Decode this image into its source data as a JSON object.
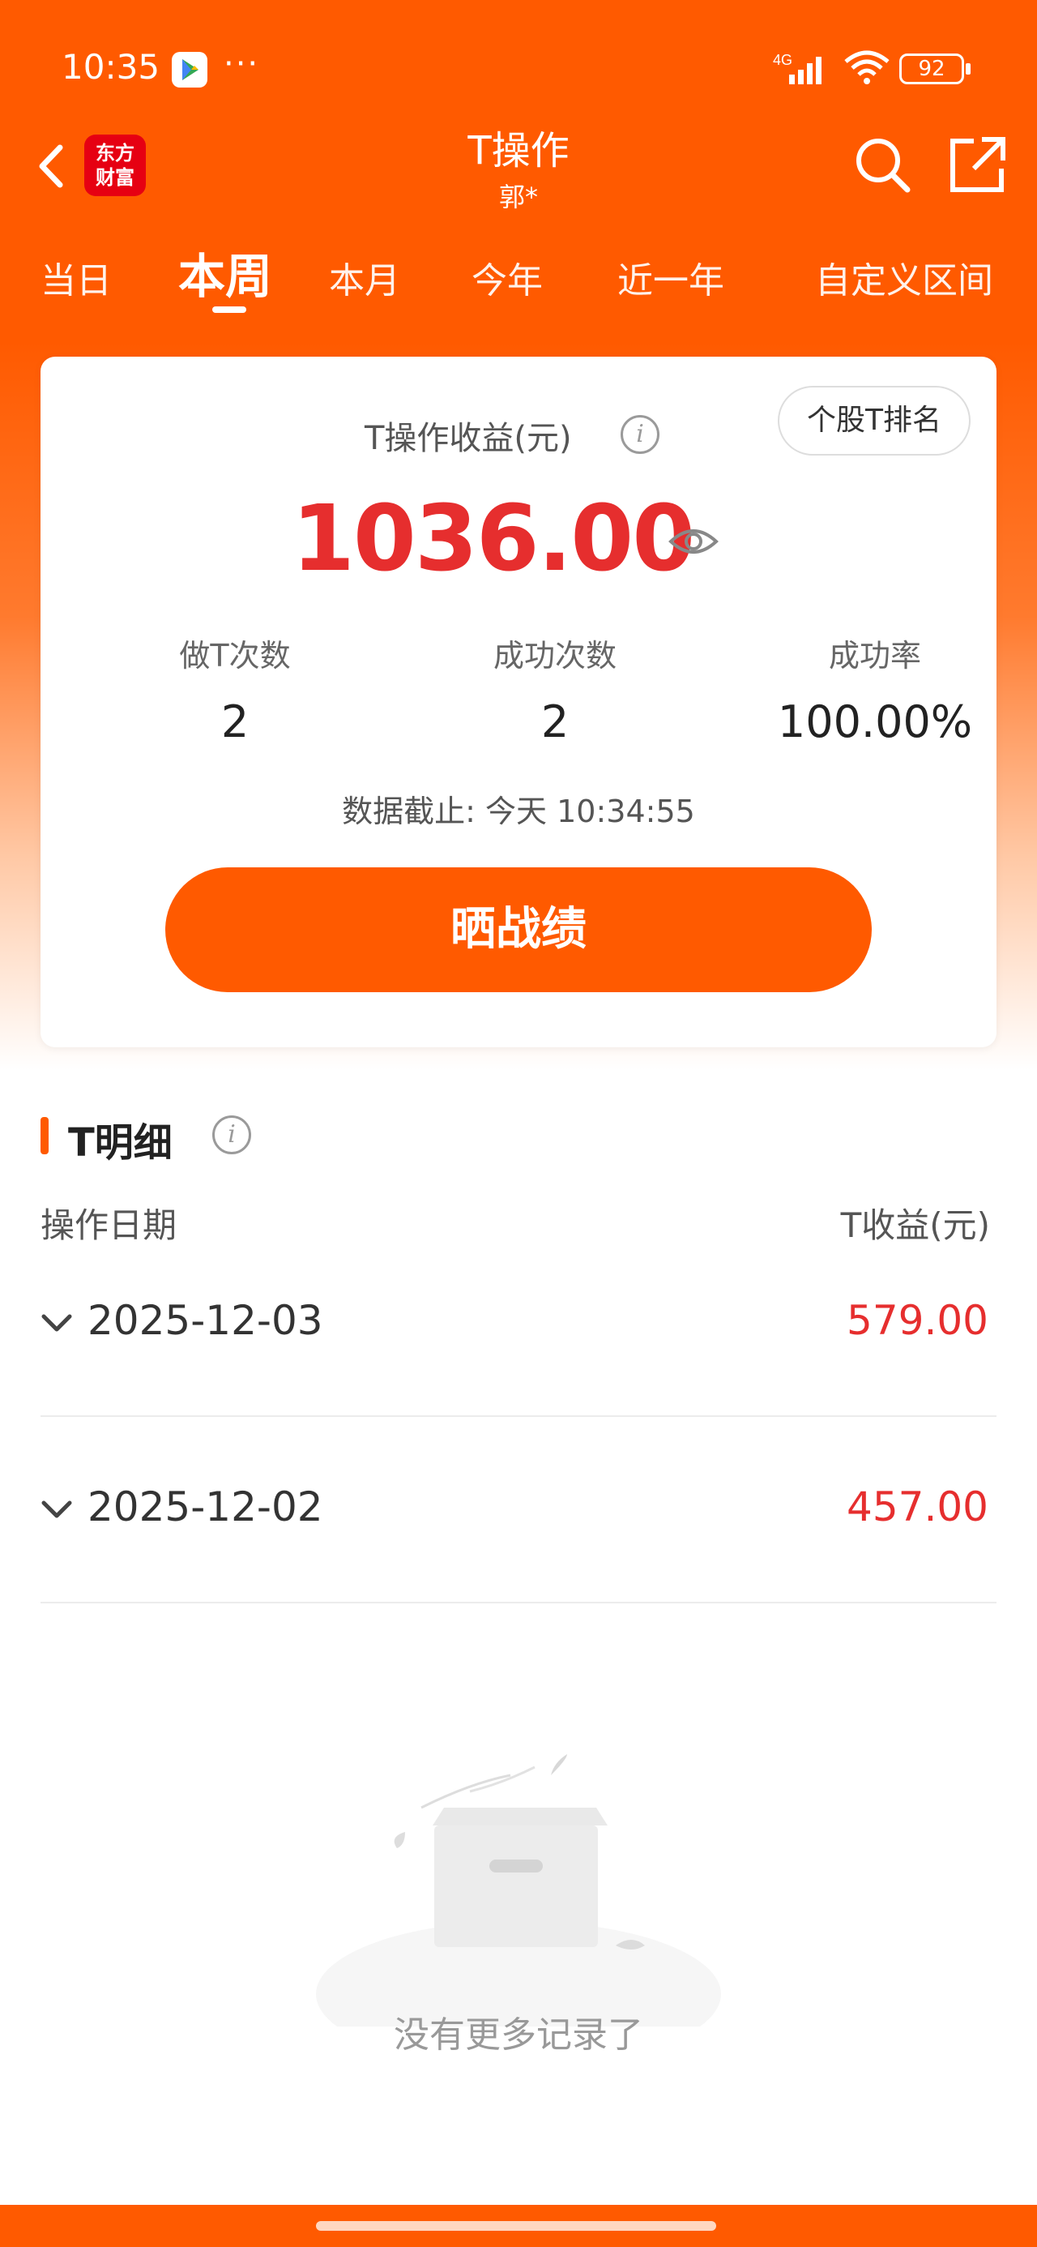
{
  "status_bar": {
    "time": "10:35",
    "dots": "···",
    "network": "4G",
    "battery": "92"
  },
  "header": {
    "logo_line1": "东方",
    "logo_line2": "财富",
    "title": "T操作",
    "subtitle": "郭*"
  },
  "tabs": [
    {
      "label": "当日",
      "active": false
    },
    {
      "label": "本周",
      "active": true
    },
    {
      "label": "本月",
      "active": false
    },
    {
      "label": "今年",
      "active": false
    },
    {
      "label": "近一年",
      "active": false
    },
    {
      "label": "自定义区间",
      "active": false
    }
  ],
  "summary": {
    "rank_button": "个股T排名",
    "profit_label": "T操作收益(元)",
    "profit_value": "1036.00",
    "stats": [
      {
        "label": "做T次数",
        "value": "2"
      },
      {
        "label": "成功次数",
        "value": "2"
      },
      {
        "label": "成功率",
        "value": "100.00%"
      }
    ],
    "data_as_of": "数据截止: 今天 10:34:55",
    "share_button": "晒战绩"
  },
  "detail": {
    "section_title": "T明细",
    "col_date": "操作日期",
    "col_profit": "T收益(元)",
    "rows": [
      {
        "date": "2025-12-03",
        "profit": "579.00"
      },
      {
        "date": "2025-12-02",
        "profit": "457.00"
      }
    ],
    "empty_text": "没有更多记录了"
  },
  "colors": {
    "brand_orange": "#ff5a00",
    "profit_red": "#e62e2e"
  },
  "icons": [
    "back-icon",
    "search-icon",
    "share-icon",
    "info-icon",
    "eye-icon",
    "chevron-down-icon"
  ]
}
